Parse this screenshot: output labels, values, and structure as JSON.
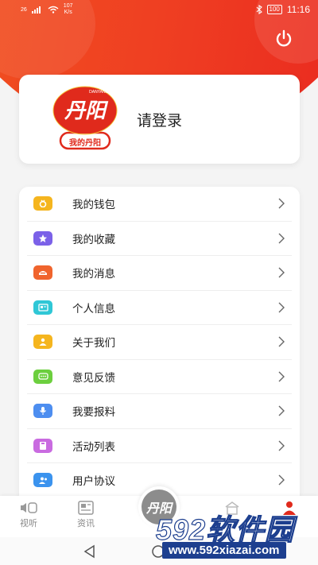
{
  "status_bar": {
    "signal": "26",
    "net_speed_value": "107",
    "net_speed_unit": "K/s",
    "battery": "100",
    "time": "11:16"
  },
  "profile": {
    "logo_brand": "丹阳",
    "logo_sub": "我的丹阳",
    "logo_en": "DANYANG",
    "login_label": "请登录"
  },
  "menu": {
    "items": [
      {
        "label": "我的钱包",
        "icon": "wallet-icon",
        "color": "#f5b51e"
      },
      {
        "label": "我的收藏",
        "icon": "star-icon",
        "color": "#7b61e8"
      },
      {
        "label": "我的消息",
        "icon": "message-icon",
        "color": "#f0642d"
      },
      {
        "label": "个人信息",
        "icon": "id-card-icon",
        "color": "#2fc7d6"
      },
      {
        "label": "关于我们",
        "icon": "person-icon",
        "color": "#f5b51e"
      },
      {
        "label": "意见反馈",
        "icon": "chat-icon",
        "color": "#6ccf3e"
      },
      {
        "label": "我要报料",
        "icon": "mic-icon",
        "color": "#4d8ef0"
      },
      {
        "label": "活动列表",
        "icon": "list-icon",
        "color": "#c96be0"
      },
      {
        "label": "用户协议",
        "icon": "users-icon",
        "color": "#3b93ee"
      }
    ]
  },
  "tabbar": {
    "tabs": [
      {
        "label": "视听",
        "icon": "audio-video-icon"
      },
      {
        "label": "资讯",
        "icon": "news-icon"
      },
      {
        "label": "丹阳",
        "icon": "home-logo-icon"
      }
    ]
  },
  "watermark": {
    "brand": "592软件园",
    "url": "www.592xiazai.com"
  },
  "colors": {
    "accent": "#ef3f22",
    "watermark": "#1d3f8f"
  }
}
